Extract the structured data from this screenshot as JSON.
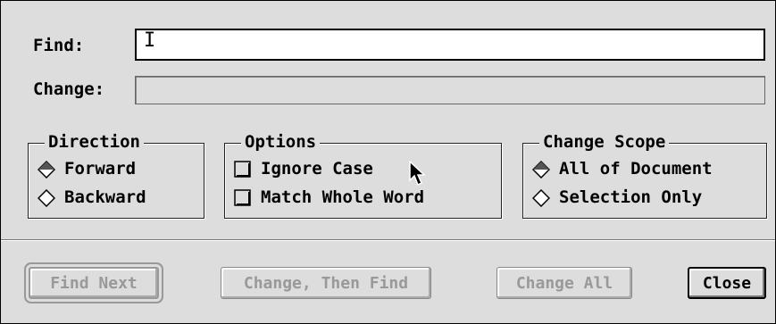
{
  "find": {
    "label": "Find:",
    "value": ""
  },
  "change": {
    "label": "Change:",
    "value": ""
  },
  "direction": {
    "title": "Direction",
    "options": [
      {
        "label": "Forward",
        "selected": true
      },
      {
        "label": "Backward",
        "selected": false
      }
    ]
  },
  "options": {
    "title": "Options",
    "items": [
      {
        "label": "Ignore Case",
        "checked": false
      },
      {
        "label": "Match Whole Word",
        "checked": false
      }
    ]
  },
  "scope": {
    "title": "Change Scope",
    "options": [
      {
        "label": "All of Document",
        "selected": true
      },
      {
        "label": "Selection Only",
        "selected": false
      }
    ]
  },
  "buttons": {
    "find_next": "Find Next",
    "change_then_find": "Change, Then Find",
    "change_all": "Change All",
    "close": "Close"
  },
  "colors": {
    "dialog_bg": "#dddddd",
    "disabled_text": "#999999"
  },
  "icons": {
    "radio": "diamond-radio-icon",
    "check": "checkbox-icon",
    "pointer": "arrow-cursor-icon"
  }
}
